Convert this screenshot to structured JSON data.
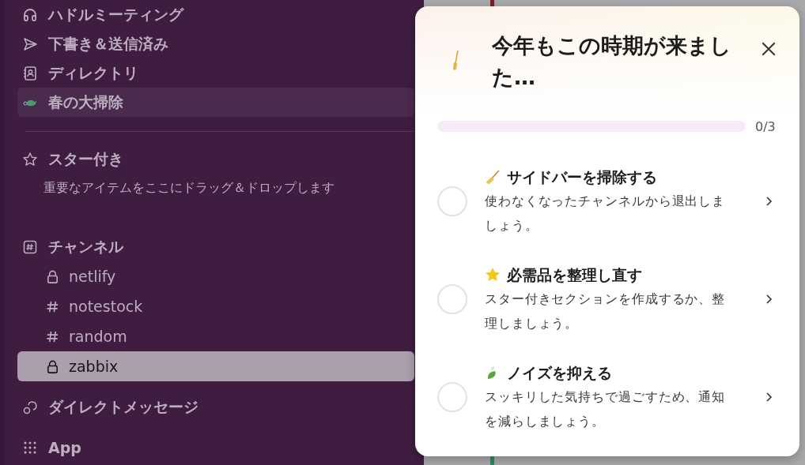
{
  "sidebar": {
    "nav": [
      {
        "kind": "headphones",
        "label": "ハドルミーティング",
        "selected": false
      },
      {
        "kind": "send",
        "label": "下書き＆送信済み",
        "selected": false
      },
      {
        "kind": "directory",
        "label": "ディレクトリ",
        "selected": false
      },
      {
        "kind": "cleanup",
        "label": "春の大掃除",
        "selected": true
      }
    ],
    "starred": {
      "title": "スター付き",
      "hint": "重要なアイテムをここにドラッグ＆ドロップします"
    },
    "channels": {
      "title": "チャンネル",
      "items": [
        {
          "kind": "private",
          "name": "netlify",
          "selected": false
        },
        {
          "kind": "public",
          "name": "notestock",
          "selected": false
        },
        {
          "kind": "public",
          "name": "random",
          "selected": false
        },
        {
          "kind": "private",
          "name": "zabbix",
          "selected": true
        }
      ]
    },
    "direct_messages": {
      "title": "ダイレクトメッセージ"
    },
    "apps": {
      "title": "App"
    }
  },
  "panel": {
    "title": "今年もこの時期が来ました…",
    "progress": {
      "level": 0,
      "reading": "0/3"
    },
    "tasks": [
      {
        "kind": "broom",
        "title": "サイドバーを掃除する",
        "description": "使わなくなったチャンネルから退出しましょう。",
        "done": false
      },
      {
        "kind": "star",
        "title": "必需品を整理し直す",
        "description": "スター付きセクションを作成するか、整理しましょう。",
        "done": false
      },
      {
        "kind": "leaf",
        "title": "ノイズを抑える",
        "description": "スッキリした気持ちで過ごすため、通知を減らしましょう。",
        "done": false
      }
    ]
  }
}
